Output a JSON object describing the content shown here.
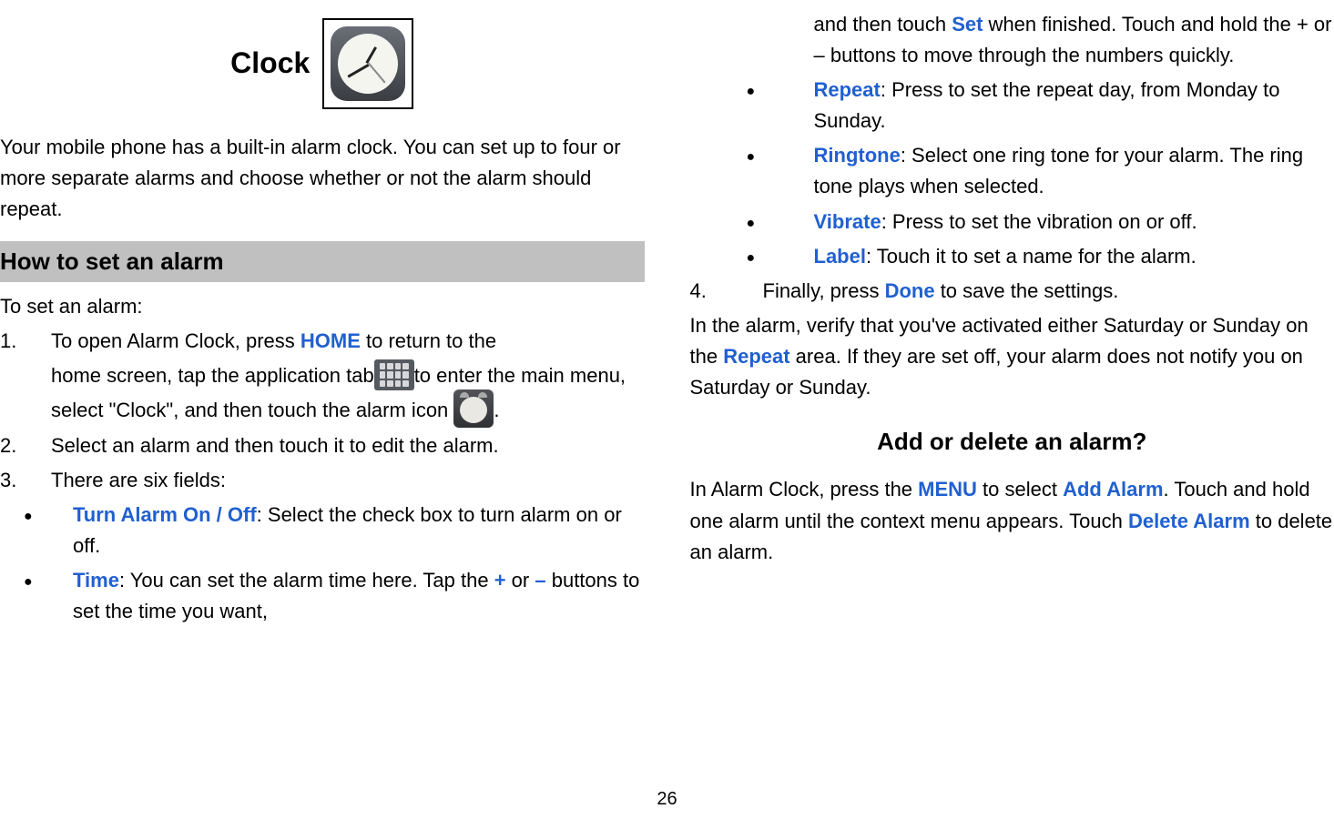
{
  "title": "Clock",
  "intro": "Your mobile phone has a built-in alarm clock. You can set up to four or more separate alarms and choose whether or not the alarm should repeat.",
  "section1_heading": "How to set an alarm",
  "to_set": "To set an alarm:",
  "steps": {
    "s1_num": "1.",
    "s1a": "To open Alarm Clock, press ",
    "s1_home": "HOME",
    "s1b": " to return to the",
    "s1c": "home screen, tap the application tab",
    "s1d": "to enter the main menu, select \"Clock\", and then touch the alarm icon",
    "s1e": ".",
    "s2_num": "2.",
    "s2": "Select an alarm and then touch it to edit the alarm.",
    "s3_num": "3.",
    "s3": "There are six fields:",
    "s4_num": "4.",
    "s4a": "Finally, press ",
    "s4_done": "Done",
    "s4b": " to save the settings."
  },
  "fields": {
    "f1_label": "Turn Alarm On / Off",
    "f1_text": ": Select the check box to turn alarm on or off.",
    "f2_label": "Time",
    "f2_text_a": ": You can set the alarm time here. Tap the ",
    "f2_plus": "+",
    "f2_mid": " or ",
    "f2_minus": "–",
    "f2_text_b": " buttons to set the time you want,",
    "f2_cont_a": "and then touch ",
    "f2_set": "Set",
    "f2_cont_b": " when finished. Touch and hold the + or – buttons to move through the numbers quickly.",
    "f3_label": "Repeat",
    "f3_text": ": Press to set the repeat day, from Monday to Sunday.",
    "f4_label": "Ringtone",
    "f4_text": ": Select one ring tone for your alarm. The ring tone plays when selected.",
    "f5_label": "Vibrate",
    "f5_text": ": Press to set the vibration on or off.",
    "f6_label": "Label",
    "f6_text": ": Touch it to set a name for the alarm."
  },
  "note_a": "In the alarm, verify that you've activated either Saturday or Sunday on the ",
  "note_repeat": "Repeat",
  "note_b": " area. If they are set off, your alarm does not notify you on Saturday or Sunday.",
  "section2_heading": "Add or delete an alarm?",
  "add_a": "In Alarm Clock, press the ",
  "add_menu": "MENU",
  "add_b": " to select ",
  "add_addalarm": "Add Alarm",
  "add_c": ". Touch and hold one alarm until the context menu appears. Touch ",
  "add_delete": "Delete Alarm",
  "add_d": " to delete an alarm.",
  "page_number": "26"
}
